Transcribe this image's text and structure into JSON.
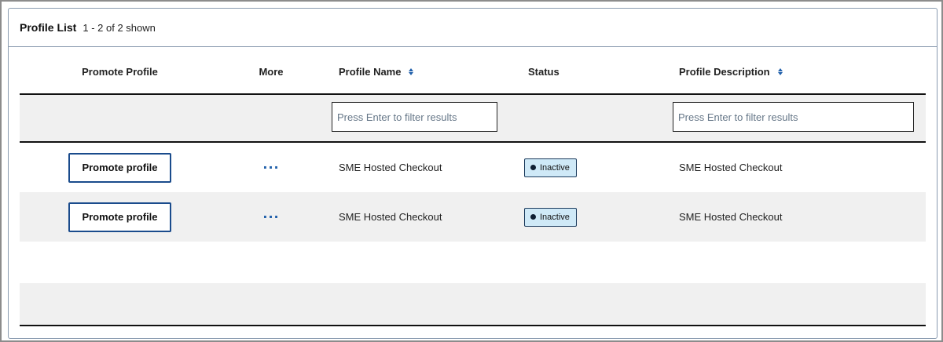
{
  "header": {
    "title": "Profile List",
    "count": "1 - 2 of 2 shown"
  },
  "columns": {
    "promote": "Promote Profile",
    "more": "More",
    "name": "Profile Name",
    "status": "Status",
    "description": "Profile Description"
  },
  "filters": {
    "name_placeholder": "Press Enter to filter results",
    "description_placeholder": "Press Enter to filter results"
  },
  "rows": [
    {
      "promote_label": "Promote profile",
      "more_label": "···",
      "name": "SME Hosted Checkout",
      "status": "Inactive",
      "description": "SME Hosted Checkout"
    },
    {
      "promote_label": "Promote profile",
      "more_label": "···",
      "name": "SME Hosted Checkout",
      "status": "Inactive",
      "description": "SME Hosted Checkout"
    }
  ],
  "colors": {
    "accent": "#1f5faa",
    "badge_bg": "#cfe9f7",
    "row_alt": "#f0f0f0"
  },
  "icons": {
    "sort": "sort-icon",
    "more": "more-dots-icon",
    "status": "status-dot-icon"
  }
}
